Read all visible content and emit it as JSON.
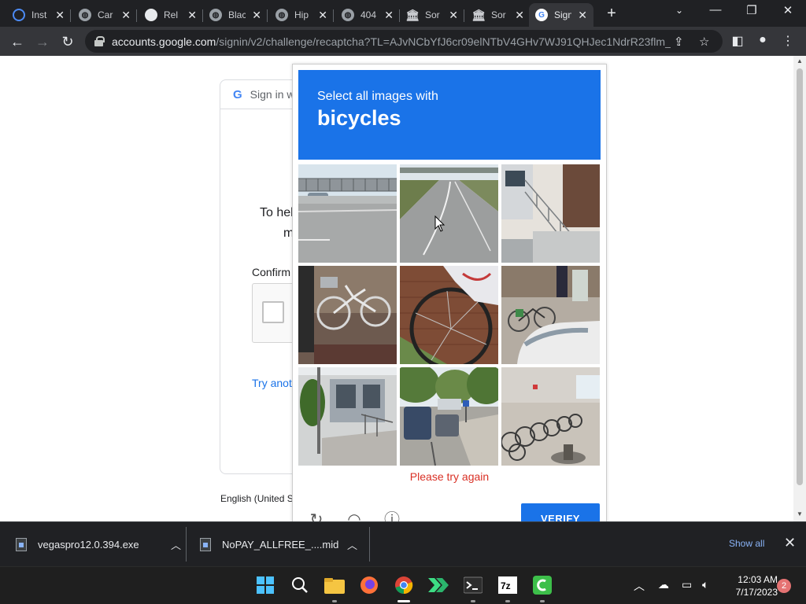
{
  "browser": {
    "tabs": [
      {
        "title": "Inst",
        "icon": "edge-icon"
      },
      {
        "title": "Car",
        "icon": "globe-icon"
      },
      {
        "title": "Rel",
        "icon": "github-icon"
      },
      {
        "title": "Blac",
        "icon": "globe-icon"
      },
      {
        "title": "Hip",
        "icon": "globe-icon"
      },
      {
        "title": "404",
        "icon": "globe-icon"
      },
      {
        "title": "Sor",
        "icon": "bank-icon"
      },
      {
        "title": "Sor",
        "icon": "bank-icon"
      },
      {
        "title": "Sign",
        "icon": "google-icon",
        "active": true
      }
    ],
    "url_host": "accounts.google.com",
    "url_path": "/signin/v2/challenge/recaptcha?TL=AJvNCbYfJ6cr09elNTbV4GHv7WJ91QHJec1NdrR23flm_...",
    "colors": {
      "accent": "#1a73e8",
      "error": "#d93025"
    }
  },
  "signin": {
    "header": "Sign in w",
    "google_letter": "G",
    "text_line1": "To hel",
    "text_line2": "m",
    "confirm_label": "Confirm",
    "try_another": "Try anot",
    "footer_language": "English (United S"
  },
  "captcha": {
    "instruction": "Select all images with",
    "target": "bicycles",
    "error_message": "Please try again",
    "verify_label": "VERIFY",
    "tiles": [
      {
        "subject": "road-with-railing"
      },
      {
        "subject": "empty-road"
      },
      {
        "subject": "stairs-building"
      },
      {
        "subject": "bicycle-parked"
      },
      {
        "subject": "bicycle-wheel-closeup"
      },
      {
        "subject": "bicycles-and-car"
      },
      {
        "subject": "building-ramp"
      },
      {
        "subject": "street-with-cars"
      },
      {
        "subject": "parked-bicycles-row"
      }
    ]
  },
  "downloads": {
    "items": [
      {
        "name": "vegaspro12.0.394.exe"
      },
      {
        "name": "NoPAY_ALLFREE_....mid"
      }
    ],
    "show_all": "Show all"
  },
  "taskbar": {
    "time": "12:03 AM",
    "date": "7/17/2023",
    "notification_count": "2"
  }
}
